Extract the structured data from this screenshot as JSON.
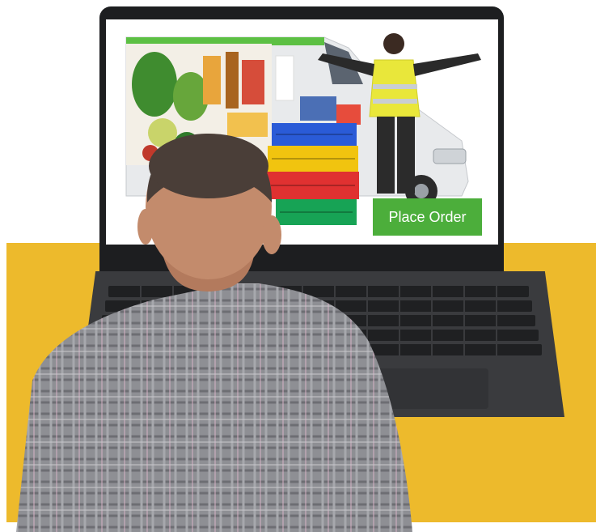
{
  "screen": {
    "cta_label": "Place Order"
  },
  "colors": {
    "background_panel": "#EDBA2C",
    "cta_green": "#4CAE3B",
    "vest_yellow": "#E9E73A",
    "laptop_dark": "#1d1e20"
  }
}
